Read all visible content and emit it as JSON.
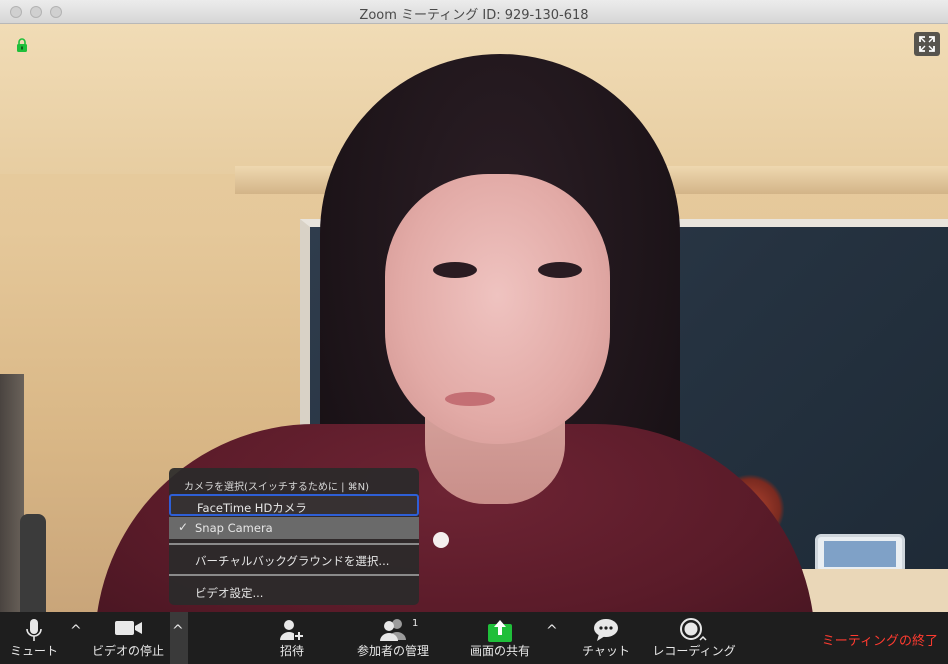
{
  "window": {
    "title": "Zoom ミーティング ID: 929-130-618"
  },
  "video": {
    "lock_icon": "lock-icon",
    "fullscreen_icon": "fullscreen-icon"
  },
  "camera_menu": {
    "header": "カメラを選択(スイッチするために | ⌘N)",
    "items": [
      {
        "label": "FaceTime HDカメラ",
        "checked": false
      },
      {
        "label": "Snap Camera",
        "checked": true
      }
    ],
    "virtual_background": "バーチャルバックグラウンドを選択...",
    "video_settings": "ビデオ設定...",
    "check_mark": "✓"
  },
  "toolbar": {
    "mute": "ミュート",
    "stop_video": "ビデオの停止",
    "invite": "招待",
    "participants": "参加者の管理",
    "participants_count": "1",
    "share_screen": "画面の共有",
    "chat": "チャット",
    "record": "レコーディング",
    "end_meeting": "ミーティングの終了",
    "caret": "^"
  },
  "colors": {
    "end_meeting": "#ff3b30",
    "share_green": "#1fbf3a",
    "focus_ring": "#2e5fd6"
  }
}
